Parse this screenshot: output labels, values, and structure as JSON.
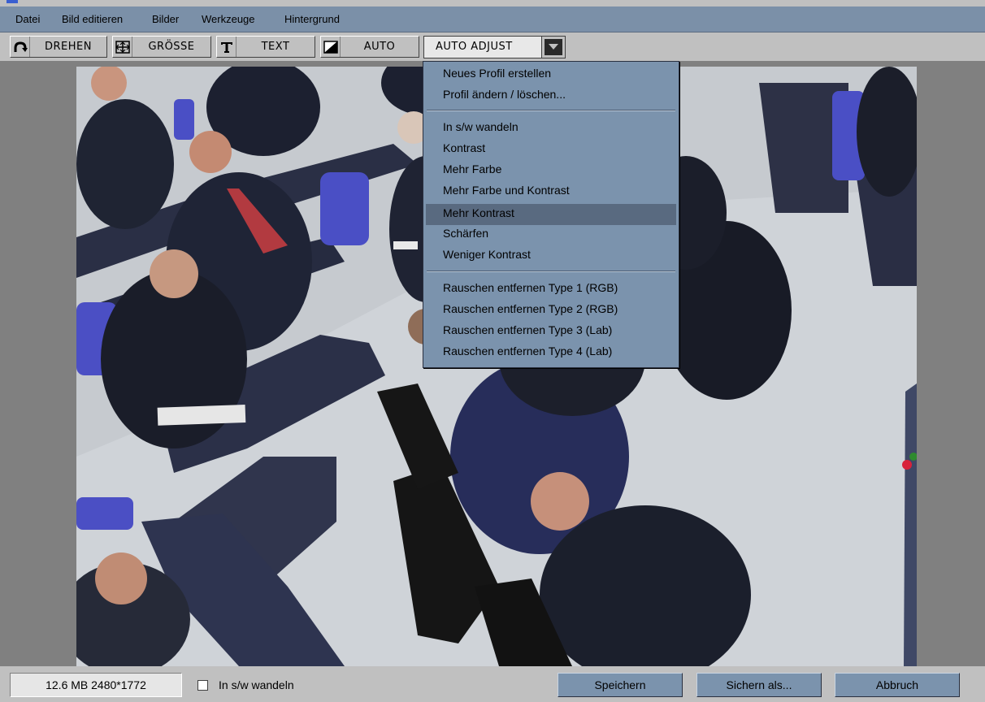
{
  "menubar": {
    "items": [
      "Datei",
      "Bild editieren",
      "Bilder",
      "Werkzeuge",
      "Hintergrund"
    ]
  },
  "toolbar": {
    "rotate_label": "DREHEN",
    "size_label": "GRÖSSE",
    "text_label": "TEXT",
    "auto_label": "AUTO",
    "dropdown_value": "AUTO ADJUST"
  },
  "dropdown_menu": {
    "group1": [
      "Neues Profil erstellen",
      "Profil ändern / löschen..."
    ],
    "group2": [
      "In s/w wandeln",
      "Kontrast",
      "Mehr Farbe",
      "Mehr Farbe und Kontrast",
      "Mehr Kontrast",
      "Schärfen",
      "Weniger Kontrast"
    ],
    "group3": [
      "Rauschen entfernen Type 1 (RGB)",
      "Rauschen entfernen Type 2 (RGB)",
      "Rauschen entfernen Type 3 (Lab)",
      "Rauschen entfernen Type 4 (Lab)"
    ],
    "highlighted": "Mehr Kontrast"
  },
  "status": {
    "image_info": "12.6 MB  2480*1772",
    "bw_checkbox_label": "In s/w wandeln",
    "bw_checked": false,
    "save_label": "Speichern",
    "save_as_label": "Sichern als...",
    "cancel_label": "Abbruch"
  },
  "colors": {
    "menubar_bg": "#7b90a8",
    "menu_bg": "#7b93ad",
    "highlight_bg": "#596a80",
    "window_bg": "#c0c0c0",
    "workspace_bg": "#808080"
  }
}
